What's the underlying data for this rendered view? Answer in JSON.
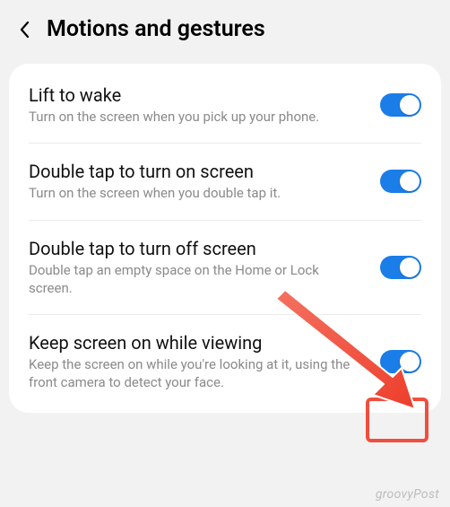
{
  "header": {
    "title": "Motions and gestures"
  },
  "settings": [
    {
      "title": "Lift to wake",
      "desc": "Turn on the screen when you pick up your phone.",
      "on": true
    },
    {
      "title": "Double tap to turn on screen",
      "desc": "Turn on the screen when you double tap it.",
      "on": true
    },
    {
      "title": "Double tap to turn off screen",
      "desc": "Double tap an empty space on the Home or Lock screen.",
      "on": true
    },
    {
      "title": "Keep screen on while viewing",
      "desc": "Keep the screen on while you're looking at it, using the front camera to detect your face.",
      "on": true
    }
  ],
  "watermark": "groovyPost",
  "annotation": {
    "arrow_color": "#f04e3e",
    "highlight_color": "#f04e3e"
  }
}
